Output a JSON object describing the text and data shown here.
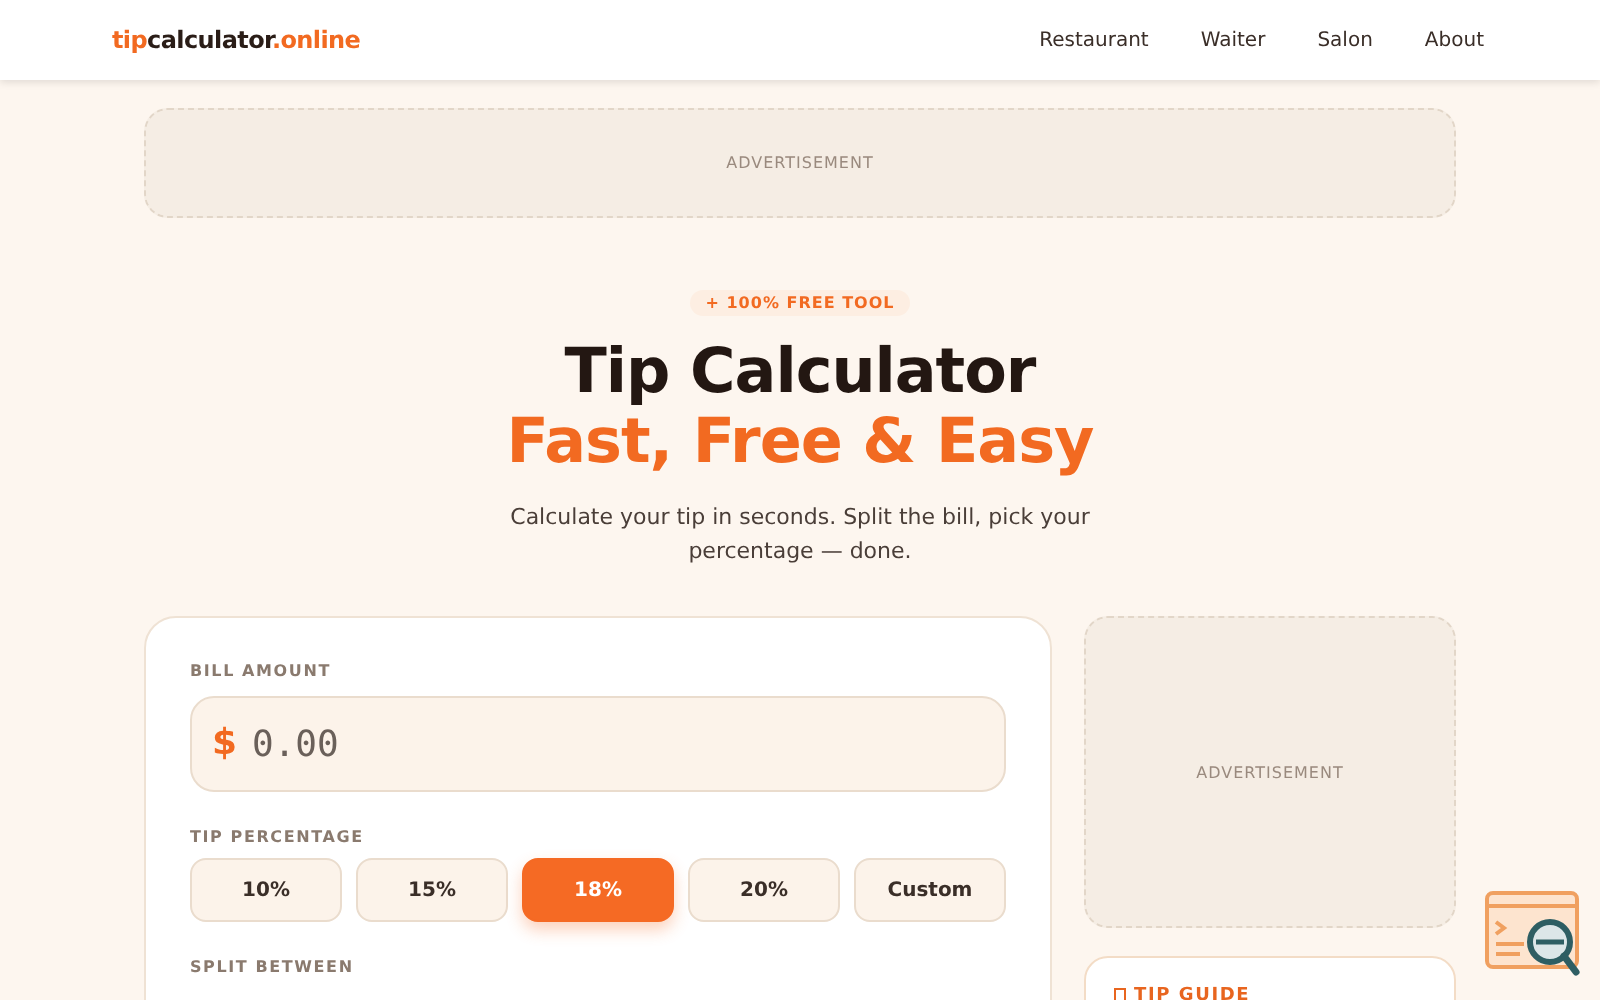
{
  "header": {
    "logo": {
      "prefix": "tip",
      "middle": "calculator",
      "suffix": ".online"
    },
    "nav": [
      {
        "label": "Restaurant"
      },
      {
        "label": "Waiter"
      },
      {
        "label": "Salon"
      },
      {
        "label": "About"
      }
    ]
  },
  "top_ad": {
    "label": "ADVERTISEMENT"
  },
  "hero": {
    "badge": "+ 100% FREE TOOL",
    "title": "Tip Calculator",
    "subtitle": "Fast, Free & Easy",
    "description": "Calculate your tip in seconds. Split the bill, pick your percentage — done."
  },
  "calculator": {
    "bill_label": "BILL AMOUNT",
    "currency": "$",
    "bill_placeholder": "0.00",
    "tip_label": "TIP PERCENTAGE",
    "tips": [
      {
        "label": "10%",
        "selected": false
      },
      {
        "label": "15%",
        "selected": false
      },
      {
        "label": "18%",
        "selected": true
      },
      {
        "label": "20%",
        "selected": false
      },
      {
        "label": "Custom",
        "selected": false
      }
    ],
    "split_label": "SPLIT BETWEEN"
  },
  "side_ad": {
    "label": "ADVERTISEMENT"
  },
  "tip_guide": {
    "title": "TIP GUIDE"
  }
}
